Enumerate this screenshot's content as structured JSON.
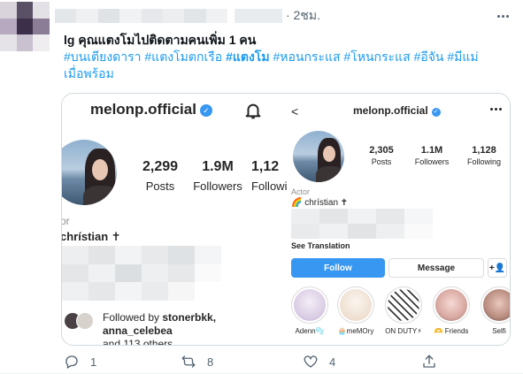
{
  "tweet": {
    "time": "· 2ชม.",
    "text_lead": "lg คุณแตงโมไปติดตามคนเพิ่ม 1 คน",
    "hashtags": {
      "h1": "#บนเตียงดารา",
      "h2": "#แตงโมตกเรือ",
      "h3": "#แตงโม",
      "h4": "#หอนกระแส",
      "h5": "#โหนกระแส",
      "h6": "#อีจัน",
      "h7": "#มีแม่",
      "h8": "เมื่อพร้อม"
    },
    "more_icon": "more-horizontal-icon"
  },
  "left_screenshot": {
    "username": "melonp.official",
    "stats": [
      {
        "num": "2,299",
        "label": "Posts"
      },
      {
        "num": "1.9M",
        "label": "Followers"
      },
      {
        "num": "1,12",
        "label": "Followi"
      }
    ],
    "actor_label": "or",
    "display_name": "chrístian ✝",
    "followed_prefix": "Followed by ",
    "followed_names": "stonerbkk, anna_celebea",
    "followed_suffix": "and 113 others"
  },
  "right_screenshot": {
    "back_glyph": "<",
    "username": "melonp.official",
    "stats": [
      {
        "num": "2,305",
        "label": "Posts"
      },
      {
        "num": "1.1M",
        "label": "Followers"
      },
      {
        "num": "1,128",
        "label": "Following"
      }
    ],
    "actor_label": "Actor",
    "display_name": "🌈 chrístian ✝",
    "see_translation": "See Translation",
    "follow_label": "Follow",
    "message_label": "Message",
    "add_user_glyph": "+👤",
    "highlights": [
      {
        "caption": "Adenn🫧"
      },
      {
        "caption": "🧁meMOry"
      },
      {
        "caption": "ON DUTY⚡"
      },
      {
        "caption": "🫶 Friends"
      },
      {
        "caption": "Selfi"
      }
    ]
  },
  "actions": {
    "reply_count": "1",
    "retweet_count": "8",
    "like_count": "4"
  },
  "colors": {
    "twitter_blue": "#1d9bf0",
    "instagram_blue": "#3897f0",
    "muted": "#536471"
  }
}
